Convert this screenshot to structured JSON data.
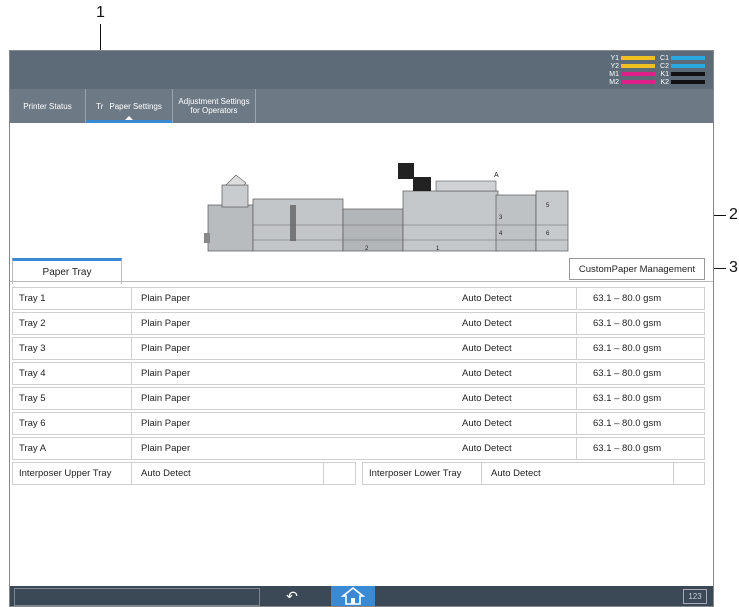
{
  "callouts": {
    "c1": "1",
    "c2": "2",
    "c3": "3"
  },
  "toners": [
    {
      "label": "Y1",
      "color": "#f0c020"
    },
    {
      "label": "C1",
      "color": "#2aa6e0"
    },
    {
      "label": "Y2",
      "color": "#f0c020"
    },
    {
      "label": "C2",
      "color": "#2aa6e0"
    },
    {
      "label": "M1",
      "color": "#e0208a"
    },
    {
      "label": "K1",
      "color": "#111111"
    },
    {
      "label": "M2",
      "color": "#e0208a"
    },
    {
      "label": "K2",
      "color": "#111111"
    }
  ],
  "tabs": {
    "printer_status": "Printer Status",
    "tray_part": "Tr",
    "paper_settings": "Paper Settings",
    "adjustment_1": "Adjustment Settings",
    "adjustment_2": "for Operators"
  },
  "printer_labels": {
    "a": "A",
    "t3": "3",
    "t4": "4",
    "t5": "5",
    "t6": "6",
    "t1": "1",
    "t2": "2"
  },
  "paper_tray_tab": "Paper Tray",
  "custom_paper_button": "CustomPaper Management",
  "trays": [
    {
      "name": "Tray 1",
      "type": "Plain Paper",
      "size": "Auto Detect",
      "weight": "63.1 – 80.0 gsm"
    },
    {
      "name": "Tray 2",
      "type": "Plain Paper",
      "size": "Auto Detect",
      "weight": "63.1 – 80.0 gsm"
    },
    {
      "name": "Tray 3",
      "type": "Plain Paper",
      "size": "Auto Detect",
      "weight": "63.1 – 80.0 gsm"
    },
    {
      "name": "Tray 4",
      "type": "Plain Paper",
      "size": "Auto Detect",
      "weight": "63.1 – 80.0 gsm"
    },
    {
      "name": "Tray 5",
      "type": "Plain Paper",
      "size": "Auto Detect",
      "weight": "63.1 – 80.0 gsm"
    },
    {
      "name": "Tray 6",
      "type": "Plain Paper",
      "size": "Auto Detect",
      "weight": "63.1 – 80.0 gsm"
    },
    {
      "name": "Tray A",
      "type": "Plain Paper",
      "size": "Auto Detect",
      "weight": "63.1 – 80.0 gsm"
    }
  ],
  "interposer": {
    "upper_label": "Interposer Upper Tray",
    "upper_value": "Auto Detect",
    "lower_label": "Interposer Lower Tray",
    "lower_value": "Auto Detect"
  },
  "bottom": {
    "back_icon": "back-arrow-icon",
    "home_icon": "home-icon",
    "keyboard": "123"
  }
}
